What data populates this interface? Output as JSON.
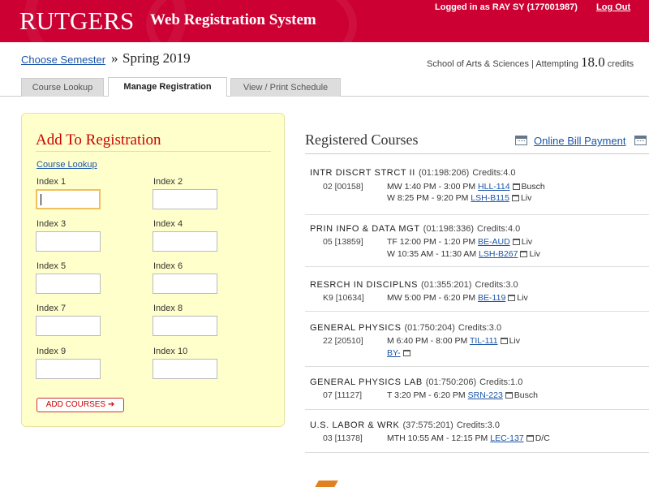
{
  "header": {
    "logo": "RUTGERS",
    "app_title": "Web Registration System",
    "user_info": "Logged in as RAY SY (177001987)",
    "logout": "Log Out",
    "brand_color": "#cc0033"
  },
  "semester": {
    "choose_label": "Choose Semester",
    "separator": "»",
    "current": "Spring 2019",
    "school": "School of Arts & Sciences | Attempting",
    "credits": "18.0",
    "credits_unit": "credits"
  },
  "tabs": [
    {
      "label": "Course Lookup",
      "active": false
    },
    {
      "label": "Manage Registration",
      "active": true
    },
    {
      "label": "View / Print Schedule",
      "active": false
    }
  ],
  "add_panel": {
    "title": "Add To Registration",
    "lookup_link": "Course Lookup",
    "index_labels": [
      "Index 1",
      "Index 2",
      "Index 3",
      "Index 4",
      "Index 5",
      "Index 6",
      "Index 7",
      "Index 8",
      "Index 9",
      "Index 10"
    ],
    "button": "ADD COURSES ➔"
  },
  "registered": {
    "title": "Registered Courses",
    "bill_link": "Online Bill Payment",
    "courses": [
      {
        "name": "INTR DISCRT STRCT II",
        "code": "(01:198:206)",
        "credits": "Credits:4.0",
        "section": "02 [00158]",
        "meetings": [
          {
            "time": "MW 1:40 PM - 3:00 PM",
            "room": "HLL-114",
            "campus": "Busch"
          },
          {
            "time": "W 8:25 PM - 9:20 PM",
            "room": "LSH-B115",
            "campus": "Liv"
          }
        ]
      },
      {
        "name": "PRIN INFO & DATA MGT",
        "code": "(01:198:336)",
        "credits": "Credits:4.0",
        "section": "05 [13859]",
        "meetings": [
          {
            "time": "TF 12:00 PM - 1:20 PM",
            "room": "BE-AUD",
            "campus": "Liv"
          },
          {
            "time": "W 10:35 AM - 11:30 AM",
            "room": "LSH-B267",
            "campus": "Liv"
          }
        ]
      },
      {
        "name": "RESRCH IN DISCIPLNS",
        "code": "(01:355:201)",
        "credits": "Credits:3.0",
        "section": "K9 [10634]",
        "meetings": [
          {
            "time": "MW 5:00 PM - 6:20 PM",
            "room": "BE-119",
            "campus": "Liv"
          }
        ]
      },
      {
        "name": "GENERAL PHYSICS",
        "code": "(01:750:204)",
        "credits": "Credits:3.0",
        "section": "22 [20510]",
        "meetings": [
          {
            "time": "M 6:40 PM - 8:00 PM",
            "room": "TIL-111",
            "campus": "Liv"
          },
          {
            "time": "",
            "room": "BY-",
            "campus": ""
          }
        ]
      },
      {
        "name": "GENERAL PHYSICS LAB",
        "code": "(01:750:206)",
        "credits": "Credits:1.0",
        "section": "07 [11127]",
        "meetings": [
          {
            "time": "T 3:20 PM - 6:20 PM",
            "room": "SRN-223",
            "campus": "Busch"
          }
        ]
      },
      {
        "name": "U.S. LABOR & WRK",
        "code": "(37:575:201)",
        "credits": "Credits:3.0",
        "section": "03 [11378]",
        "meetings": [
          {
            "time": "MTH 10:55 AM - 12:15 PM",
            "room": "LEC-137",
            "campus": "D/C"
          }
        ]
      }
    ]
  }
}
